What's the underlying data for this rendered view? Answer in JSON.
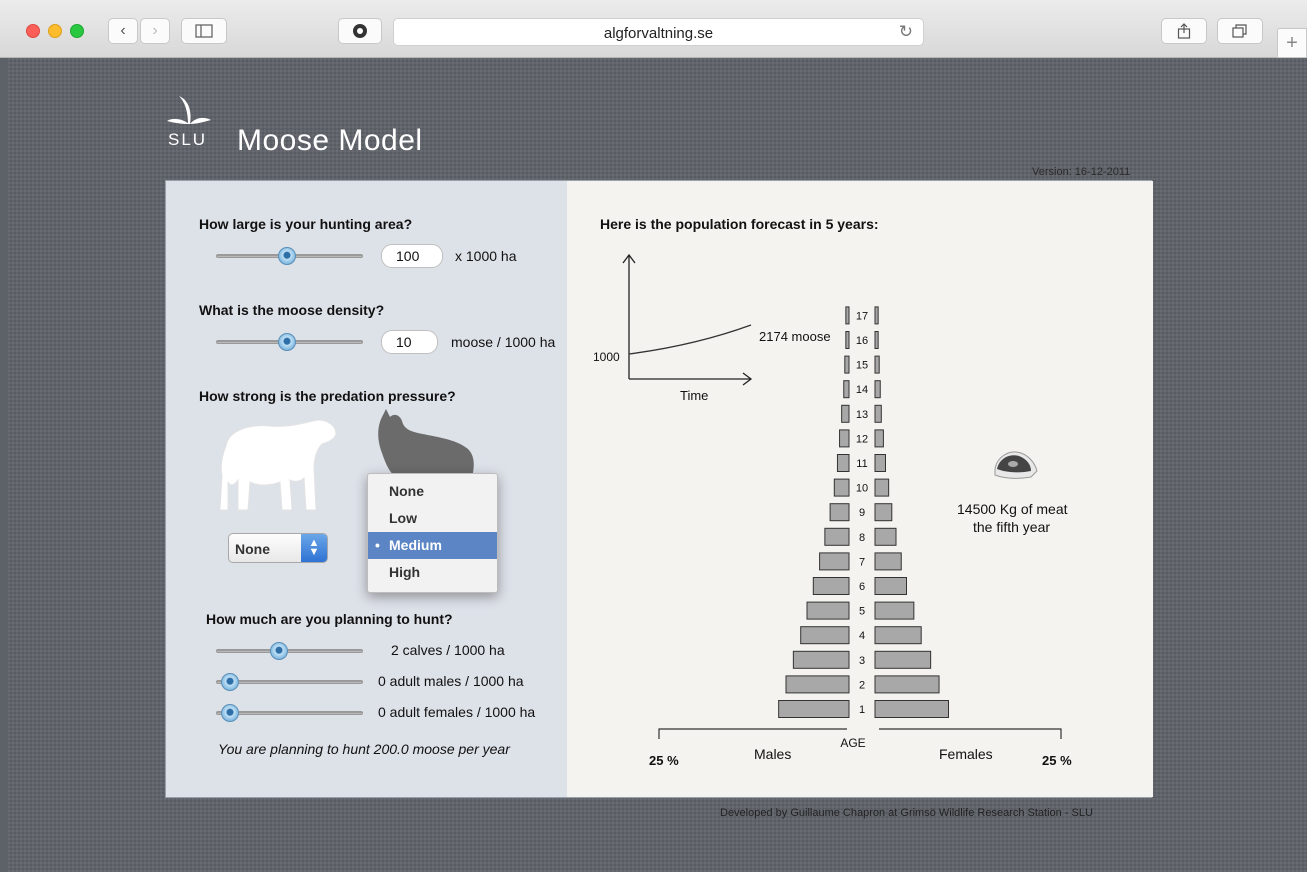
{
  "browser": {
    "url": "algforvaltning.se"
  },
  "header": {
    "logo_text": "SLU",
    "title": "Moose Model",
    "version": "Version: 16-12-2011"
  },
  "area": {
    "question": "How large is your hunting area?",
    "value": "100",
    "unit": "x 1000 ha"
  },
  "density": {
    "question": "What is the moose density?",
    "value": "10",
    "unit": "moose / 1000 ha"
  },
  "predation": {
    "question": "How  strong is the predation pressure?",
    "bear_select_value": "None",
    "wolf_options": [
      "None",
      "Low",
      "Medium",
      "High"
    ],
    "wolf_selected": "Medium"
  },
  "hunting": {
    "question": "How much are you planning to hunt?",
    "calves": "2 calves / 1000 ha",
    "males": "0 adult males / 1000 ha",
    "females": "0 adult females / 1000 ha",
    "summary": "You are planning to hunt 200.0 moose per year"
  },
  "forecast": {
    "title": "Here is the population forecast in 5 years:",
    "start_label": "1000",
    "end_label": "2174 moose",
    "time_label": "Time",
    "meat_line1": "14500 Kg of meat",
    "meat_line2": "the fifth year"
  },
  "pyramid": {
    "age_label": "AGE",
    "males_label": "Males",
    "females_label": "Females",
    "left_pct": "25 %",
    "right_pct": "25 %"
  },
  "chart_data": {
    "type": "bar",
    "categories": [
      "1",
      "2",
      "3",
      "4",
      "5",
      "6",
      "7",
      "8",
      "9",
      "10",
      "11",
      "12",
      "13",
      "14",
      "15",
      "16",
      "17"
    ],
    "series": [
      {
        "name": "Males",
        "values": [
          6.7,
          6.0,
          5.3,
          4.6,
          4.0,
          3.4,
          2.8,
          2.3,
          1.8,
          1.4,
          1.1,
          0.9,
          0.7,
          0.5,
          0.4,
          0.3,
          0.3
        ]
      },
      {
        "name": "Females",
        "values": [
          7.0,
          6.1,
          5.3,
          4.4,
          3.7,
          3.0,
          2.5,
          2.0,
          1.6,
          1.3,
          1.0,
          0.8,
          0.6,
          0.5,
          0.4,
          0.3,
          0.3
        ]
      }
    ],
    "xlabel": "AGE",
    "xlim": [
      0,
      25
    ]
  },
  "footer": {
    "credit": "Developed by Guillaume Chapron at Grimsö Wildlife Research Station - SLU"
  }
}
